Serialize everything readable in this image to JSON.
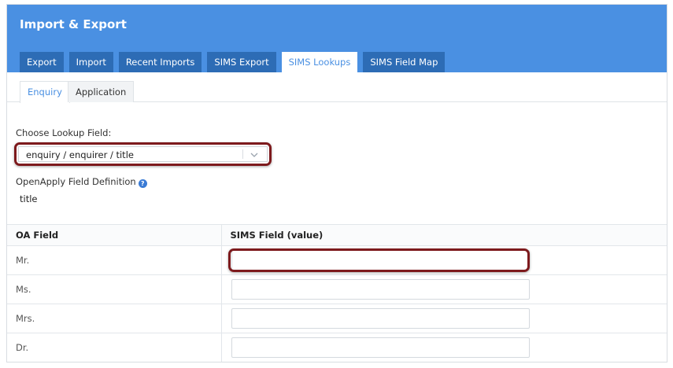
{
  "header": {
    "title": "Import & Export",
    "tabs": [
      {
        "label": "Export",
        "active": false
      },
      {
        "label": "Import",
        "active": false
      },
      {
        "label": "Recent Imports",
        "active": false
      },
      {
        "label": "SIMS Export",
        "active": false
      },
      {
        "label": "SIMS Lookups",
        "active": true
      },
      {
        "label": "SIMS Field Map",
        "active": false
      }
    ]
  },
  "subtabs": [
    {
      "label": "Enquiry",
      "active": true
    },
    {
      "label": "Application",
      "active": false
    }
  ],
  "lookup": {
    "label": "Choose Lookup Field:",
    "selected": "enquiry / enquirer / title"
  },
  "definition": {
    "label": "OpenApply Field Definition",
    "value": "title",
    "help_icon": "question-circle-icon"
  },
  "table": {
    "headers": [
      "OA Field",
      "SIMS Field (value)"
    ],
    "rows": [
      {
        "oa_field": "Mr.",
        "sims_value": ""
      },
      {
        "oa_field": "Ms.",
        "sims_value": ""
      },
      {
        "oa_field": "Mrs.",
        "sims_value": ""
      },
      {
        "oa_field": "Dr.",
        "sims_value": ""
      }
    ]
  },
  "colors": {
    "header_bg": "#4a90e2",
    "tab_bg": "#2d6cb5",
    "accent": "#4a90e2",
    "annotation": "#7d1a1d"
  }
}
